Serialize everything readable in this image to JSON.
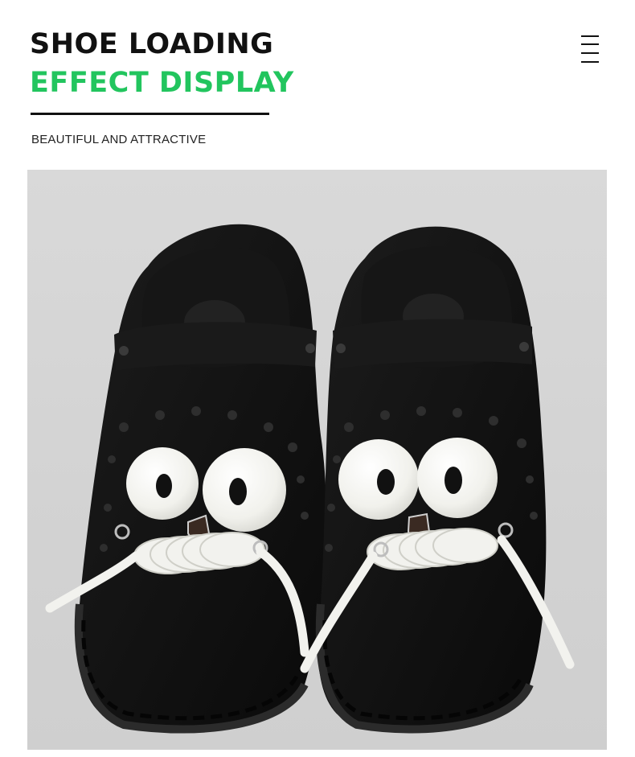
{
  "header": {
    "title_line1": "SHOE LOADING",
    "title_line2": "EFFECT DISPLAY",
    "subtitle": "BEAUTIFUL AND ATTRACTIVE",
    "menu_icon": "hamburger-menu-icon"
  },
  "colors": {
    "title_dark": "#111111",
    "title_accent": "#22c55e",
    "photo_background": "#d6d6d6",
    "shoe": "#121212",
    "laces": "#f2f2ee"
  },
  "photo": {
    "subject": "black-clog-pair-with-cartoon-eye-charms-and-white-laces"
  }
}
